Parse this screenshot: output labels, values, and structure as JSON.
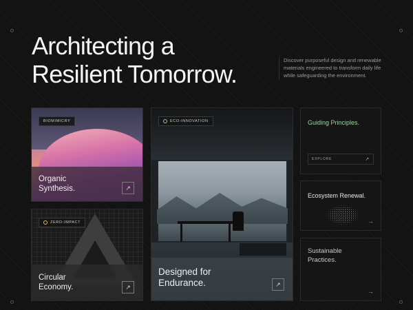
{
  "hero": {
    "headline_line1": "Architecting a",
    "headline_line2": "Resilient Tomorrow.",
    "intro": "Discover purposeful design and renewable materials engineered to transform daily life while safeguarding the environment."
  },
  "cards": [
    {
      "badge": "BIOMIMICRY",
      "title_line1": "Organic",
      "title_line2": "Synthesis.",
      "arrow": "↗"
    },
    {
      "badge": "ZERO-IMPACT",
      "title_line1": "Circular",
      "title_line2": "Economy.",
      "arrow": "↗"
    },
    {
      "badge": "ECO-INNOVATION",
      "title_line1": "Designed for",
      "title_line2": "Endurance.",
      "arrow": "↗"
    }
  ],
  "side": [
    {
      "title_line1": "Guiding Principles.",
      "button": "EXPLORE",
      "arrow": "↗"
    },
    {
      "title_line1": "Ecosystem Renewal.",
      "arrow": "→"
    },
    {
      "title_line1": "Sustainable",
      "title_line2": "Practices.",
      "arrow": "→"
    }
  ],
  "colors": {
    "accent_green": "#9ed3a9",
    "background": "#131313"
  }
}
